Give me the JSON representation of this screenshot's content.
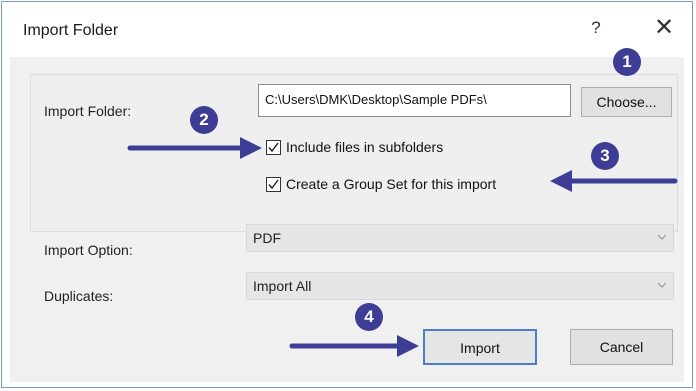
{
  "dialog": {
    "title": "Import Folder",
    "help_label": "?",
    "close_label": "✕"
  },
  "folder": {
    "label": "Import Folder:",
    "path": "C:\\Users\\DMK\\Desktop\\Sample PDFs\\",
    "choose_label": "Choose..."
  },
  "options": {
    "subfolders_label": "Include files in subfolders",
    "subfolders_checked": true,
    "group_set_label": "Create a Group Set for this import",
    "group_set_checked": true
  },
  "import_option": {
    "label": "Import Option:",
    "value": "PDF"
  },
  "duplicates": {
    "label": "Duplicates:",
    "value": "Import All"
  },
  "actions": {
    "import_label": "Import",
    "cancel_label": "Cancel"
  },
  "annotations": {
    "badge_color": "#3e3d96",
    "arrow_color": "#3e3d96",
    "steps": [
      "1",
      "2",
      "3",
      "4"
    ]
  }
}
